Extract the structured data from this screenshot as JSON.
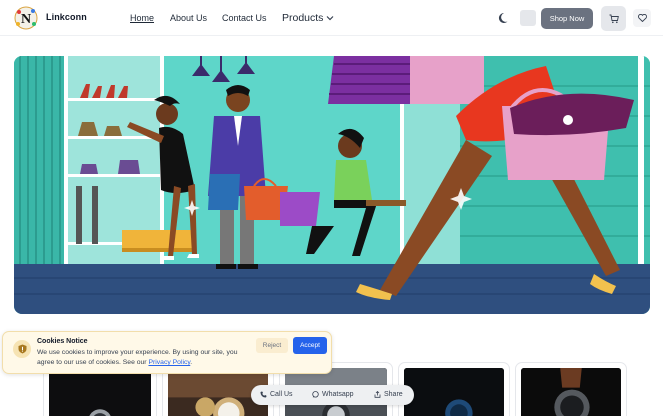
{
  "header": {
    "brand": "Linkconn",
    "logo_letter": "N",
    "nav": {
      "home": "Home",
      "about": "About Us",
      "contact": "Contact Us",
      "products": "Products"
    },
    "shop_now": "Shop Now",
    "icons": [
      "moon-icon",
      "cart-icon",
      "heart-icon",
      "chevron-down-icon"
    ]
  },
  "hero": {
    "image": "shopping-illustration"
  },
  "cookie": {
    "title": "Cookies Notice",
    "text": "We use cookies to improve your experience. By using our site, you agree to our use of cookies. See our ",
    "link": "Privacy Policy",
    "after_link": ".",
    "reject": "Reject",
    "accept": "Accept"
  },
  "share_bar": {
    "call": "Call Us",
    "whatsapp": "Whatsapp",
    "share": "Share"
  },
  "colors": {
    "accent": "#2563eb",
    "shop_button": "#6b7280",
    "cookie_bg": "#fff9e8",
    "hero_bg": "#5ed6c9"
  }
}
